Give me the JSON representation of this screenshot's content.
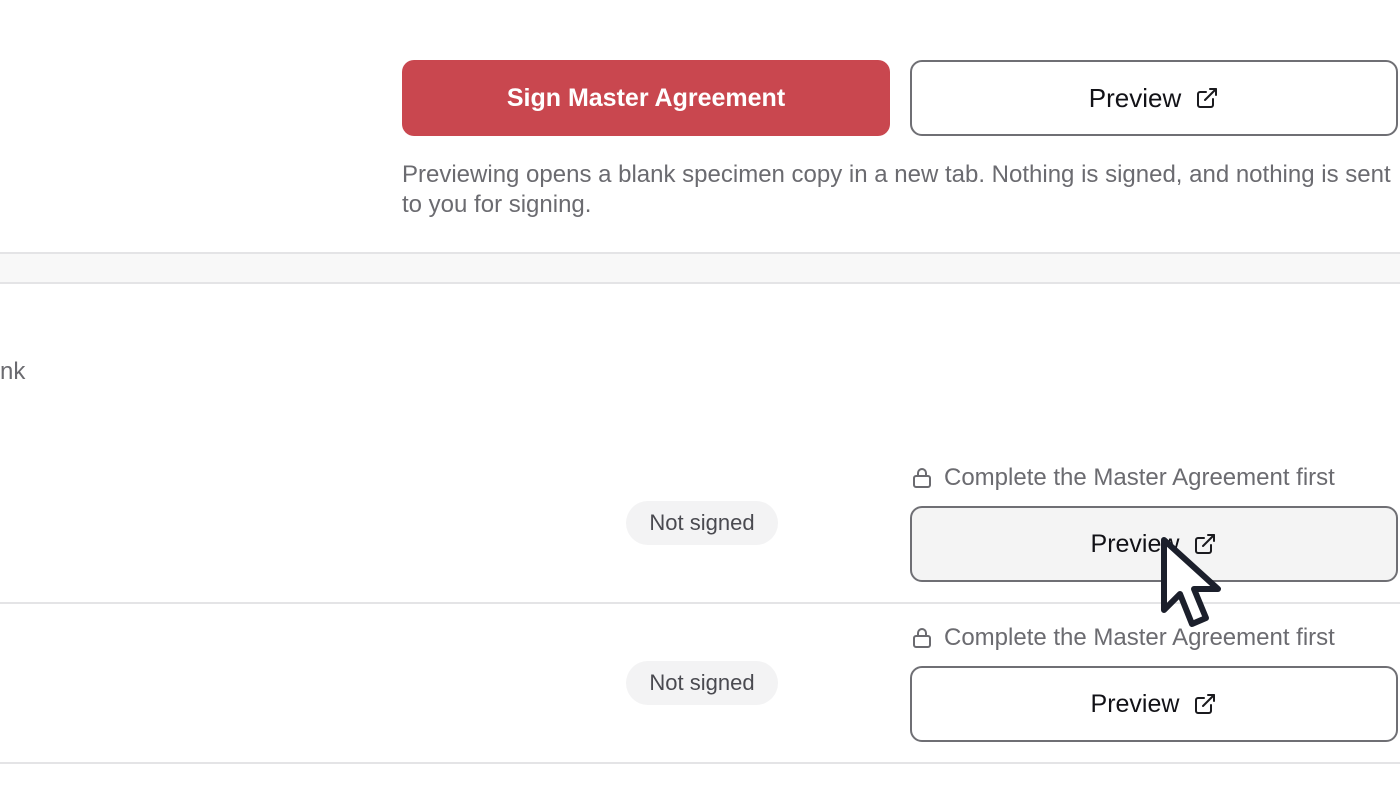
{
  "master": {
    "sign_label": "Sign Master Agreement",
    "preview_label": "Preview",
    "help_text": "Previewing opens a blank specimen copy in a new tab. Nothing is signed, and nothing is sent to you for signing."
  },
  "section": {
    "clipped_text": "blank"
  },
  "documents": [
    {
      "status": "Not signed",
      "lock_note": "Complete the Master Agreement first",
      "preview_label": "Preview"
    },
    {
      "status": "Not signed",
      "lock_note": "Complete the Master Agreement first",
      "preview_label": "Preview"
    }
  ],
  "icons": {
    "external_link": "external-link-icon",
    "lock": "lock-icon",
    "cursor": "mouse-pointer-icon"
  },
  "colors": {
    "primary": "#c9474f",
    "border": "#6f6f74",
    "muted_text": "#6b6b70",
    "badge_bg": "#f3f3f4"
  }
}
